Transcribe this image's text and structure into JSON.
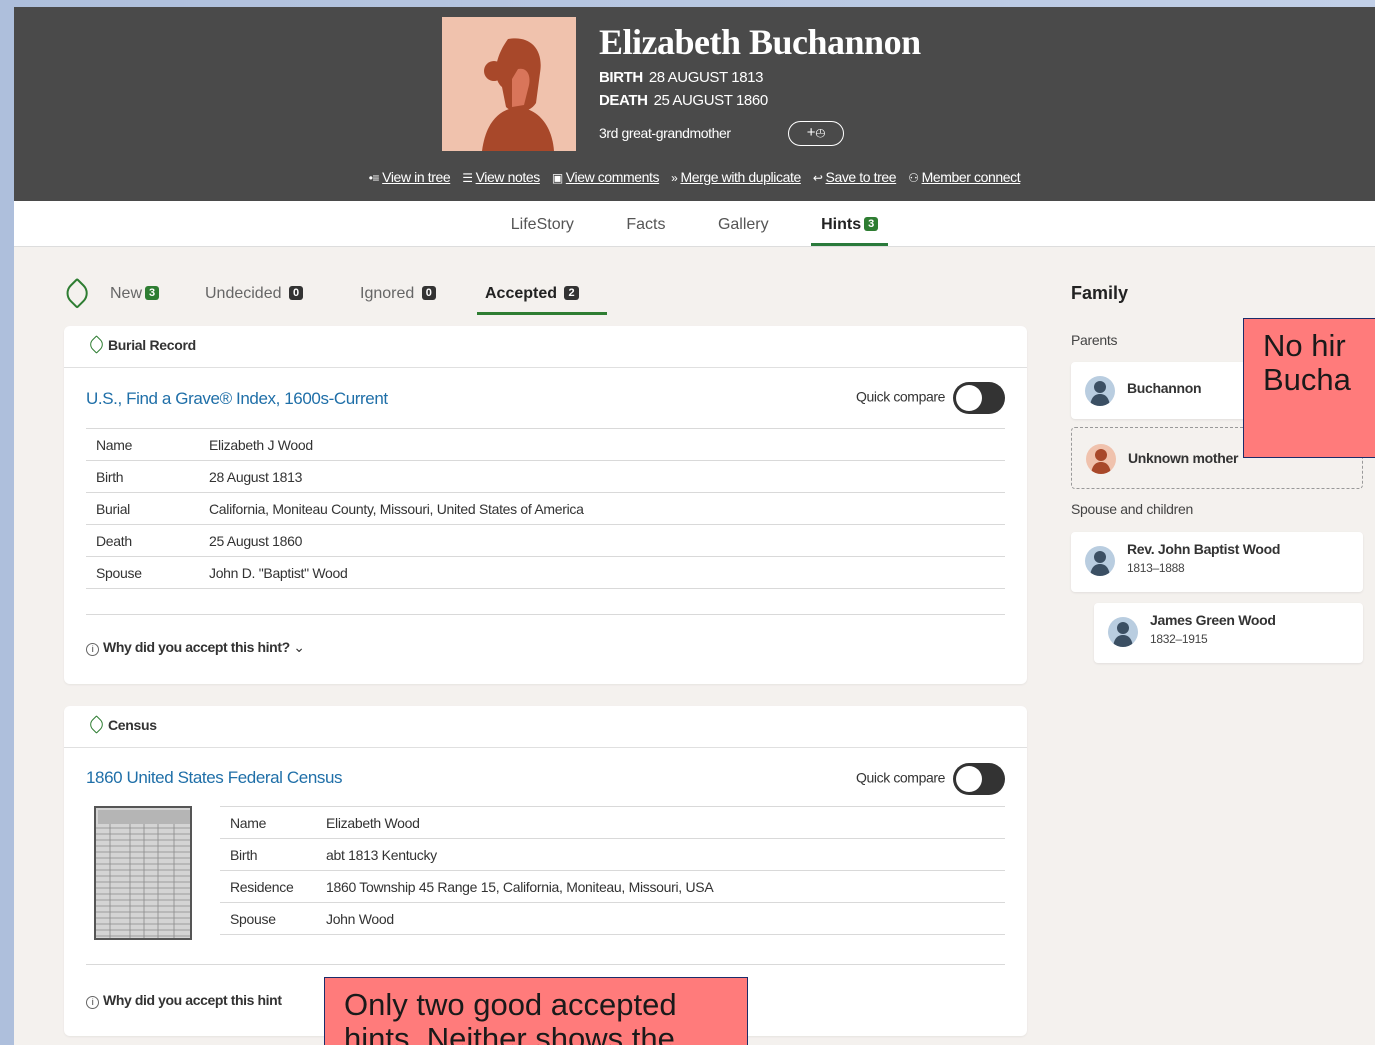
{
  "person": {
    "name": "Elizabeth Buchannon",
    "birth_label": "BIRTH",
    "birth_date": "28 AUGUST 1813",
    "death_label": "DEATH",
    "death_date": "25 AUGUST 1860",
    "relationship": "3rd great-grandmother",
    "relationship_button": "+⦺"
  },
  "actions": [
    {
      "icon": "tree-icon",
      "glyph": "•≡",
      "label": "View in tree"
    },
    {
      "icon": "notes-icon",
      "glyph": "☰",
      "label": "View notes"
    },
    {
      "icon": "comments-icon",
      "glyph": "▣",
      "label": "View comments"
    },
    {
      "icon": "merge-icon",
      "glyph": "»",
      "label": "Merge with duplicate"
    },
    {
      "icon": "save-icon",
      "glyph": "↩",
      "label": "Save to tree"
    },
    {
      "icon": "member-icon",
      "glyph": "⚇",
      "label": "Member connect"
    }
  ],
  "tabs": [
    {
      "label": "LifeStory"
    },
    {
      "label": "Facts"
    },
    {
      "label": "Gallery"
    },
    {
      "label": "Hints",
      "badge": "3"
    }
  ],
  "hint_tabs": [
    {
      "label": "New",
      "badge": "3"
    },
    {
      "label": "Undecided",
      "badge": "0"
    },
    {
      "label": "Ignored",
      "badge": "0"
    },
    {
      "label": "Accepted",
      "badge": "2"
    }
  ],
  "hints": [
    {
      "category": "Burial Record",
      "title": "U.S., Find a Grave® Index, 1600s-Current",
      "quick_compare": "Quick compare",
      "rows": [
        {
          "label": "Name",
          "value": "Elizabeth J Wood"
        },
        {
          "label": "Birth",
          "value": "28 August 1813"
        },
        {
          "label": "Burial",
          "value": "California, Moniteau County, Missouri, United States of America"
        },
        {
          "label": "Death",
          "value": "25 August 1860"
        },
        {
          "label": "Spouse",
          "value": "John D. \"Baptist\" Wood"
        }
      ],
      "why": "Why did you accept this hint?"
    },
    {
      "category": "Census",
      "title": "1860 United States Federal Census",
      "quick_compare": "Quick compare",
      "rows": [
        {
          "label": "Name",
          "value": "Elizabeth Wood"
        },
        {
          "label": "Birth",
          "value": "abt 1813 Kentucky"
        },
        {
          "label": "Residence",
          "value": "1860 Township 45 Range 15, California, Moniteau, Missouri, USA"
        },
        {
          "label": "Spouse",
          "value": "John Wood"
        }
      ],
      "why": "Why did you accept this hint"
    }
  ],
  "family": {
    "title": "Family",
    "parents_label": "Parents",
    "parents": [
      {
        "name": "Buchannon",
        "years": ""
      },
      {
        "name": "Unknown mother",
        "years": ""
      }
    ],
    "spouse_label": "Spouse and children",
    "spouse": {
      "name": "Rev. John Baptist Wood",
      "years": "1813–1888"
    },
    "children": [
      {
        "name": "James Green Wood",
        "years": "1832–1915"
      }
    ]
  },
  "callouts": {
    "right_line1": "No hir",
    "right_line2": "Bucha",
    "bottom_line1": "Only two good accepted",
    "bottom_line2": "hints. Neither shows the"
  },
  "colors": {
    "header_bg": "#4a4a4a",
    "accent_green": "#2e7d32",
    "link_blue": "#1f6fa8",
    "callout_red": "#ff7b7b"
  }
}
